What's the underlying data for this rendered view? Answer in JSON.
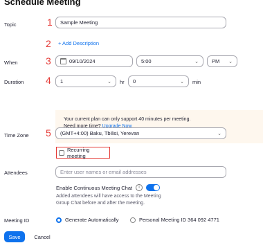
{
  "page": {
    "title": "Schedule Meeting"
  },
  "labels": {
    "topic": "Topic",
    "when": "When",
    "duration": "Duration",
    "time_zone": "Time Zone",
    "attendees": "Attendees",
    "meeting_id": "Meeting ID"
  },
  "markers": [
    "1",
    "2",
    "3",
    "4",
    "5"
  ],
  "topic": {
    "value": "Sample Meeting"
  },
  "description": {
    "add_label": "+ Add Description"
  },
  "when": {
    "date": "09/10/2024",
    "time": "5:00",
    "ampm": "PM"
  },
  "duration": {
    "hours": "1",
    "hr_label": "hr",
    "minutes": "0",
    "min_label": "min"
  },
  "notice": {
    "line1": "Your current plan can only support 40 minutes per meeting.",
    "line2_prefix": "Need more time?",
    "upgrade_link": "Upgrade Now"
  },
  "time_zone": {
    "value": "(GMT+4:00) Baku, Tbilisi, Yerevan"
  },
  "recurring": {
    "label": "Recurring meeting",
    "checked": false
  },
  "attendees": {
    "placeholder": "Enter user names or email addresses",
    "chat_label": "Enable Continuous Meeting Chat",
    "chat_enabled": true,
    "chat_desc_line1": "Added attendees will have access to the Meeting",
    "chat_desc_line2": "Group Chat before and after the meeting."
  },
  "meeting_id": {
    "option_auto": "Generate Automatically",
    "option_personal": "Personal Meeting ID 364 092 4771"
  },
  "buttons": {
    "save": "Save",
    "cancel": "Cancel"
  },
  "colors": {
    "accent": "#0e72ed",
    "marker": "#e53935",
    "notice_bg": "#fef7ee"
  }
}
